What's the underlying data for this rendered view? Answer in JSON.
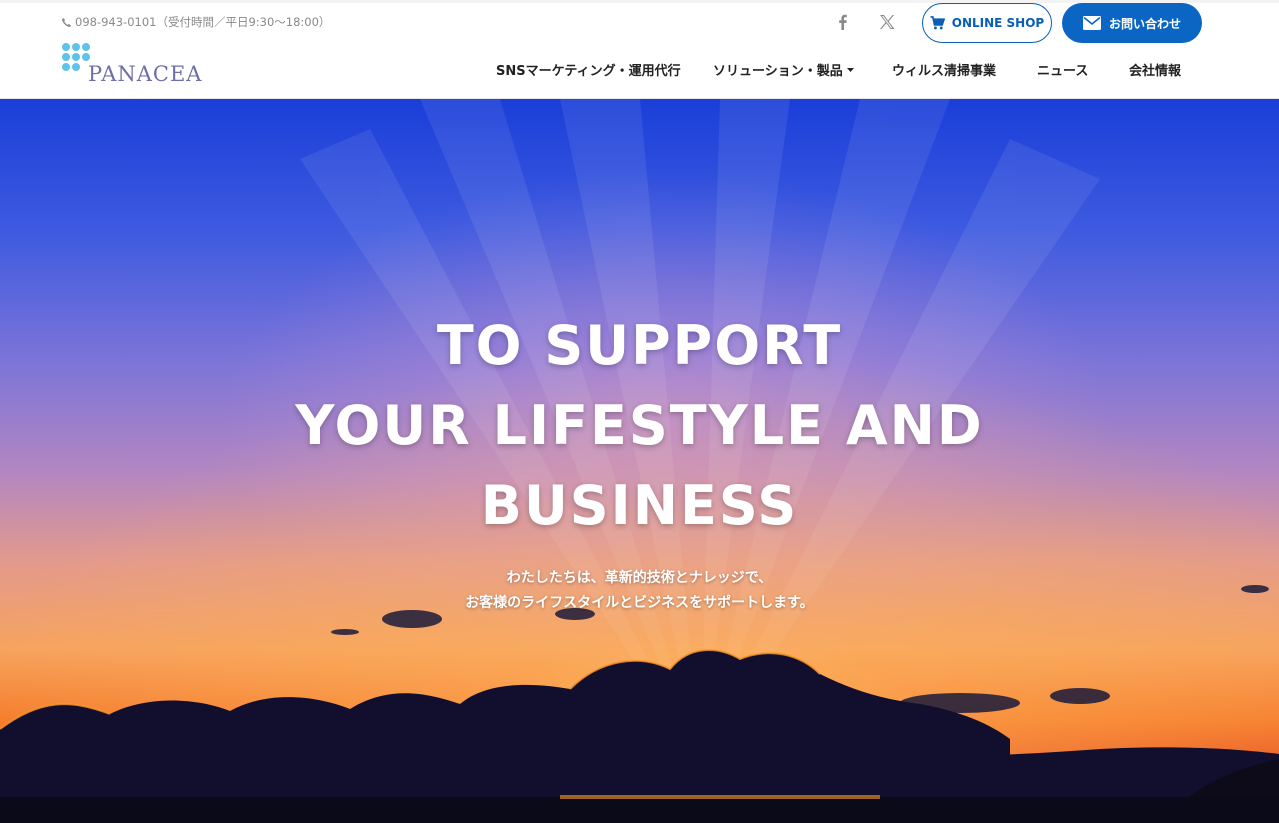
{
  "header": {
    "phone": "098-943-0101（受付時間／平日9:30〜18:00）",
    "logo_text": "PANACEA",
    "shop_label": "ONLINE SHOP",
    "contact_label": "お問い合わせ",
    "nav": [
      {
        "label": "SNSマーケティング・運用代行"
      },
      {
        "label": "ソリューション・製品"
      },
      {
        "label": "ウィルス清掃事業"
      },
      {
        "label": "ニュース"
      },
      {
        "label": "会社情報"
      }
    ]
  },
  "hero": {
    "title_lines": [
      "TO SUPPORT",
      "YOUR LIFESTYLE AND",
      "BUSINESS"
    ],
    "subtitle_lines": [
      "わたしたちは、革新的技術とナレッジで、",
      "お客様のライフスタイルとビジネスをサポートします。"
    ]
  },
  "colors": {
    "brand_blue": "#0a66c2",
    "logo_text": "#6d6fa8",
    "logo_dots": "#5ec3ea"
  }
}
